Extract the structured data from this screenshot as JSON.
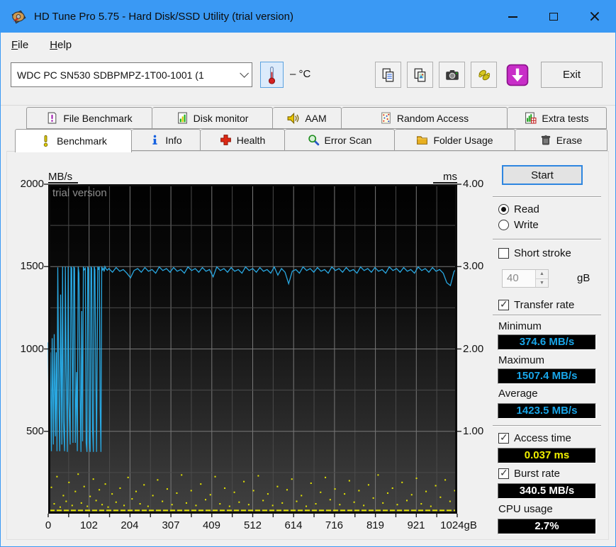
{
  "window": {
    "title": "HD Tune Pro 5.75 - Hard Disk/SSD Utility (trial version)"
  },
  "menu": {
    "file": {
      "accel": "F",
      "rest": "ile"
    },
    "help": {
      "accel": "H",
      "rest": "elp"
    }
  },
  "toolbar": {
    "drive_select_value": "WDC PC SN530 SDBPMPZ-1T00-1001 (1",
    "temperature": "– °C",
    "exit_label": "Exit",
    "buttons": [
      {
        "icon": "copy-text-icon"
      },
      {
        "icon": "copy-image-icon"
      },
      {
        "icon": "screenshot-camera-icon"
      },
      {
        "icon": "hands-icon"
      },
      {
        "icon": "download-icon"
      }
    ]
  },
  "tabs": {
    "row1": [
      {
        "label": "File Benchmark",
        "icon": "file-benchmark-icon"
      },
      {
        "label": "Disk monitor",
        "icon": "disk-monitor-icon"
      },
      {
        "label": "AAM",
        "icon": "speaker-icon"
      },
      {
        "label": "Random Access",
        "icon": "random-access-icon"
      },
      {
        "label": "Extra tests",
        "icon": "extra-tests-icon"
      }
    ],
    "row2": [
      {
        "label": "Benchmark",
        "icon": "benchmark-exclamation-icon",
        "active": true
      },
      {
        "label": "Info",
        "icon": "info-icon"
      },
      {
        "label": "Health",
        "icon": "health-cross-icon"
      },
      {
        "label": "Error Scan",
        "icon": "magnifier-icon"
      },
      {
        "label": "Folder Usage",
        "icon": "folder-icon"
      },
      {
        "label": "Erase",
        "icon": "trash-icon"
      }
    ]
  },
  "panel": {
    "start_label": "Start",
    "read_label": "Read",
    "write_label": "Write",
    "read_selected": true,
    "write_selected": false,
    "short_stroke_label": "Short stroke",
    "short_stroke_checked": false,
    "short_stroke_value": "40",
    "short_stroke_unit": "gB",
    "transfer_rate_label": "Transfer rate",
    "transfer_rate_checked": true,
    "minimum_label": "Minimum",
    "minimum_value": "374.6 MB/s",
    "maximum_label": "Maximum",
    "maximum_value": "1507.4 MB/s",
    "average_label": "Average",
    "average_value": "1423.5 MB/s",
    "access_time_label": "Access time",
    "access_time_checked": true,
    "access_time_value": "0.037 ms",
    "burst_rate_label": "Burst rate",
    "burst_rate_checked": true,
    "burst_rate_value": "340.5 MB/s",
    "cpu_usage_label": "CPU usage",
    "cpu_usage_value": "2.7%"
  },
  "colors": {
    "titlebar": "#3a99f4",
    "value_blue": "#18a5e8",
    "value_yellow": "#f0f000",
    "value_white": "#ffffff",
    "transfer_line": "#29a8e2",
    "access_dots": "#e6e600",
    "grid_minor": "#4b4b4b",
    "grid_major": "#787878"
  },
  "chart_data": {
    "type": "line",
    "watermark": "trial version",
    "x_axis": {
      "min": 0,
      "max": 1024,
      "unit": "gB",
      "ticks": [
        {
          "v": 0,
          "label": "0"
        },
        {
          "v": 102,
          "label": "102"
        },
        {
          "v": 204,
          "label": "204"
        },
        {
          "v": 307,
          "label": "307"
        },
        {
          "v": 409,
          "label": "409"
        },
        {
          "v": 512,
          "label": "512"
        },
        {
          "v": 614,
          "label": "614"
        },
        {
          "v": 716,
          "label": "716"
        },
        {
          "v": 819,
          "label": "819"
        },
        {
          "v": 921,
          "label": "921"
        },
        {
          "v": 1024,
          "label": "1024gB"
        }
      ],
      "divisions": 20
    },
    "y_left": {
      "label": "MB/s",
      "min": 0,
      "max": 2000,
      "ticks": [
        {
          "v": 2000,
          "label": "2000"
        },
        {
          "v": 1500,
          "label": "1500"
        },
        {
          "v": 1000,
          "label": "1000"
        },
        {
          "v": 500,
          "label": "500"
        }
      ],
      "divisions": 8
    },
    "y_right": {
      "label": "ms",
      "min": 0,
      "max": 4,
      "ticks": [
        {
          "v": 4,
          "label": "4.00"
        },
        {
          "v": 3,
          "label": "3.00"
        },
        {
          "v": 2,
          "label": "2.00"
        },
        {
          "v": 1,
          "label": "1.00"
        }
      ]
    },
    "series": [
      {
        "name": "Transfer rate",
        "unit": "MB/s",
        "kind": "line",
        "points": [
          [
            0,
            1040
          ],
          [
            3,
            372
          ],
          [
            5,
            980
          ],
          [
            8,
            380
          ],
          [
            10,
            1065
          ],
          [
            13,
            420
          ],
          [
            15,
            1090
          ],
          [
            18,
            470
          ],
          [
            20,
            980
          ],
          [
            22,
            380
          ],
          [
            24,
            1495
          ],
          [
            27,
            640
          ],
          [
            29,
            380
          ],
          [
            31,
            1330
          ],
          [
            34,
            420
          ],
          [
            36,
            1500
          ],
          [
            38,
            560
          ],
          [
            41,
            380
          ],
          [
            43,
            1500
          ],
          [
            45,
            860
          ],
          [
            48,
            375
          ],
          [
            50,
            1500
          ],
          [
            52,
            680
          ],
          [
            55,
            420
          ],
          [
            57,
            1500
          ],
          [
            59,
            1490
          ],
          [
            62,
            430
          ],
          [
            64,
            1500
          ],
          [
            66,
            1490
          ],
          [
            68,
            430
          ],
          [
            71,
            860
          ],
          [
            73,
            380
          ],
          [
            75,
            1500
          ],
          [
            77,
            1460
          ],
          [
            80,
            710
          ],
          [
            82,
            375
          ],
          [
            84,
            1230
          ],
          [
            86,
            440
          ],
          [
            88,
            1500
          ],
          [
            90,
            1480
          ],
          [
            93,
            1490
          ],
          [
            95,
            430
          ],
          [
            97,
            375
          ],
          [
            99,
            1500
          ],
          [
            101,
            1485
          ],
          [
            103,
            430
          ],
          [
            105,
            375
          ],
          [
            107,
            1500
          ],
          [
            109,
            1490
          ],
          [
            111,
            520
          ],
          [
            113,
            375
          ],
          [
            115,
            1500
          ],
          [
            117,
            1480
          ],
          [
            119,
            860
          ],
          [
            121,
            375
          ],
          [
            124,
            1500
          ],
          [
            126,
            1480
          ],
          [
            128,
            1500
          ],
          [
            130,
            640
          ],
          [
            132,
            375
          ],
          [
            134,
            1500
          ],
          [
            136,
            1480
          ],
          [
            138,
            1490
          ],
          [
            140,
            1470
          ],
          [
            142,
            1500
          ],
          [
            145,
            1485
          ],
          [
            148,
            1478
          ],
          [
            152,
            1488
          ],
          [
            161,
            1466
          ],
          [
            170,
            1494
          ],
          [
            179,
            1472
          ],
          [
            188,
            1482
          ],
          [
            197,
            1460
          ],
          [
            206,
            1432
          ],
          [
            215,
            1476
          ],
          [
            224,
            1488
          ],
          [
            233,
            1466
          ],
          [
            242,
            1494
          ],
          [
            251,
            1472
          ],
          [
            260,
            1482
          ],
          [
            269,
            1460
          ],
          [
            278,
            1498
          ],
          [
            287,
            1476
          ],
          [
            296,
            1488
          ],
          [
            305,
            1466
          ],
          [
            314,
            1494
          ],
          [
            323,
            1472
          ],
          [
            332,
            1482
          ],
          [
            341,
            1460
          ],
          [
            350,
            1498
          ],
          [
            359,
            1476
          ],
          [
            368,
            1488
          ],
          [
            377,
            1466
          ],
          [
            386,
            1494
          ],
          [
            395,
            1472
          ],
          [
            404,
            1482
          ],
          [
            413,
            1438
          ],
          [
            422,
            1498
          ],
          [
            431,
            1476
          ],
          [
            440,
            1488
          ],
          [
            449,
            1466
          ],
          [
            458,
            1494
          ],
          [
            467,
            1472
          ],
          [
            476,
            1482
          ],
          [
            485,
            1460
          ],
          [
            494,
            1498
          ],
          [
            503,
            1476
          ],
          [
            512,
            1488
          ],
          [
            521,
            1466
          ],
          [
            530,
            1494
          ],
          [
            539,
            1472
          ],
          [
            548,
            1482
          ],
          [
            557,
            1460
          ],
          [
            566,
            1498
          ],
          [
            575,
            1448
          ],
          [
            584,
            1488
          ],
          [
            593,
            1466
          ],
          [
            602,
            1396
          ],
          [
            611,
            1472
          ],
          [
            620,
            1482
          ],
          [
            629,
            1460
          ],
          [
            638,
            1498
          ],
          [
            647,
            1476
          ],
          [
            656,
            1488
          ],
          [
            665,
            1466
          ],
          [
            674,
            1494
          ],
          [
            683,
            1472
          ],
          [
            692,
            1482
          ],
          [
            701,
            1460
          ],
          [
            710,
            1498
          ],
          [
            719,
            1476
          ],
          [
            728,
            1488
          ],
          [
            737,
            1466
          ],
          [
            746,
            1494
          ],
          [
            755,
            1472
          ],
          [
            764,
            1482
          ],
          [
            773,
            1460
          ],
          [
            782,
            1498
          ],
          [
            791,
            1476
          ],
          [
            800,
            1488
          ],
          [
            809,
            1466
          ],
          [
            818,
            1494
          ],
          [
            827,
            1472
          ],
          [
            836,
            1482
          ],
          [
            845,
            1460
          ],
          [
            854,
            1498
          ],
          [
            863,
            1476
          ],
          [
            872,
            1488
          ],
          [
            881,
            1466
          ],
          [
            890,
            1494
          ],
          [
            899,
            1472
          ],
          [
            908,
            1482
          ],
          [
            917,
            1460
          ],
          [
            926,
            1498
          ],
          [
            935,
            1476
          ],
          [
            944,
            1488
          ],
          [
            953,
            1466
          ],
          [
            962,
            1494
          ],
          [
            971,
            1472
          ],
          [
            980,
            1482
          ],
          [
            989,
            1460
          ],
          [
            998,
            1402
          ],
          [
            1007,
            1385
          ],
          [
            1016,
            1470
          ],
          [
            1024,
            1488
          ]
        ]
      },
      {
        "name": "Access time",
        "unit": "ms",
        "kind": "scatter",
        "baseline": {
          "ms": 0.04,
          "from": 0,
          "to": 1024
        },
        "points": [
          [
            8,
            0.32
          ],
          [
            15,
            0.12
          ],
          [
            22,
            0.45
          ],
          [
            30,
            0.08
          ],
          [
            38,
            0.22
          ],
          [
            45,
            0.15
          ],
          [
            52,
            0.38
          ],
          [
            60,
            0.1
          ],
          [
            68,
            0.27
          ],
          [
            75,
            0.48
          ],
          [
            83,
            0.13
          ],
          [
            90,
            0.33
          ],
          [
            98,
            0.09
          ],
          [
            105,
            0.21
          ],
          [
            113,
            0.42
          ],
          [
            120,
            0.16
          ],
          [
            128,
            0.29
          ],
          [
            135,
            0.11
          ],
          [
            143,
            0.36
          ],
          [
            150,
            0.08
          ],
          [
            160,
            0.24
          ],
          [
            170,
            0.14
          ],
          [
            180,
            0.31
          ],
          [
            190,
            0.1
          ],
          [
            200,
            0.44
          ],
          [
            210,
            0.18
          ],
          [
            220,
            0.27
          ],
          [
            230,
            0.12
          ],
          [
            240,
            0.35
          ],
          [
            250,
            0.09
          ],
          [
            262,
            0.22
          ],
          [
            274,
            0.41
          ],
          [
            286,
            0.15
          ],
          [
            298,
            0.3
          ],
          [
            310,
            0.11
          ],
          [
            322,
            0.25
          ],
          [
            334,
            0.47
          ],
          [
            346,
            0.13
          ],
          [
            358,
            0.28
          ],
          [
            370,
            0.1
          ],
          [
            382,
            0.36
          ],
          [
            394,
            0.17
          ],
          [
            406,
            0.23
          ],
          [
            418,
            0.45
          ],
          [
            430,
            0.12
          ],
          [
            442,
            0.31
          ],
          [
            454,
            0.09
          ],
          [
            466,
            0.26
          ],
          [
            478,
            0.14
          ],
          [
            490,
            0.39
          ],
          [
            502,
            0.11
          ],
          [
            514,
            0.28
          ],
          [
            526,
            0.46
          ],
          [
            538,
            0.16
          ],
          [
            550,
            0.24
          ],
          [
            562,
            0.1
          ],
          [
            574,
            0.33
          ],
          [
            586,
            0.13
          ],
          [
            598,
            0.29
          ],
          [
            610,
            0.42
          ],
          [
            622,
            0.15
          ],
          [
            634,
            0.22
          ],
          [
            646,
            0.09
          ],
          [
            658,
            0.37
          ],
          [
            670,
            0.12
          ],
          [
            682,
            0.26
          ],
          [
            694,
            0.44
          ],
          [
            706,
            0.17
          ],
          [
            718,
            0.3
          ],
          [
            730,
            0.11
          ],
          [
            742,
            0.24
          ],
          [
            754,
            0.4
          ],
          [
            766,
            0.14
          ],
          [
            778,
            0.28
          ],
          [
            790,
            0.1
          ],
          [
            802,
            0.35
          ],
          [
            814,
            0.19
          ],
          [
            826,
            0.47
          ],
          [
            838,
            0.13
          ],
          [
            850,
            0.25
          ],
          [
            862,
            0.31
          ],
          [
            874,
            0.11
          ],
          [
            886,
            0.38
          ],
          [
            898,
            0.16
          ],
          [
            910,
            0.23
          ],
          [
            922,
            0.43
          ],
          [
            934,
            0.12
          ],
          [
            946,
            0.27
          ],
          [
            958,
            0.09
          ],
          [
            970,
            0.34
          ],
          [
            982,
            0.2
          ],
          [
            994,
            0.41
          ],
          [
            1006,
            0.15
          ],
          [
            1018,
            0.28
          ]
        ]
      }
    ]
  }
}
